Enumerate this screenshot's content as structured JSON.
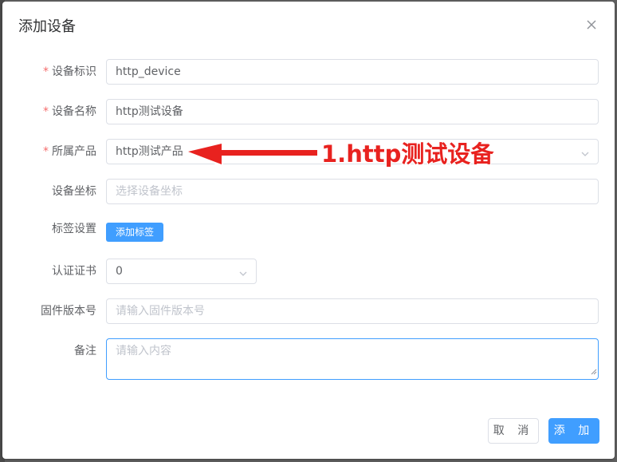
{
  "dialog": {
    "title": "添加设备",
    "close_icon": "close-icon"
  },
  "form": {
    "device_id": {
      "label": "设备标识",
      "required": true,
      "value": "http_device"
    },
    "device_name": {
      "label": "设备名称",
      "required": true,
      "value": "http测试设备"
    },
    "product": {
      "label": "所属产品",
      "required": true,
      "value": "http测试产品",
      "icon": "chevron-down-icon"
    },
    "coordinates": {
      "label": "设备坐标",
      "placeholder": "选择设备坐标"
    },
    "tags": {
      "label": "标签设置",
      "button_label": "添加标签"
    },
    "certificate": {
      "label": "认证证书",
      "value": "0",
      "icon": "chevron-down-icon"
    },
    "firmware": {
      "label": "固件版本号",
      "placeholder": "请输入固件版本号"
    },
    "remark": {
      "label": "备注",
      "placeholder": "请输入内容"
    }
  },
  "footer": {
    "cancel_label": "取 消",
    "add_label": "添 加"
  },
  "annotation": {
    "text": "1.http测试设备",
    "color": "#e8221f"
  },
  "colors": {
    "primary": "#409eff",
    "required": "#f56c6c",
    "text": "#606266",
    "placeholder": "#c0c4cc"
  }
}
